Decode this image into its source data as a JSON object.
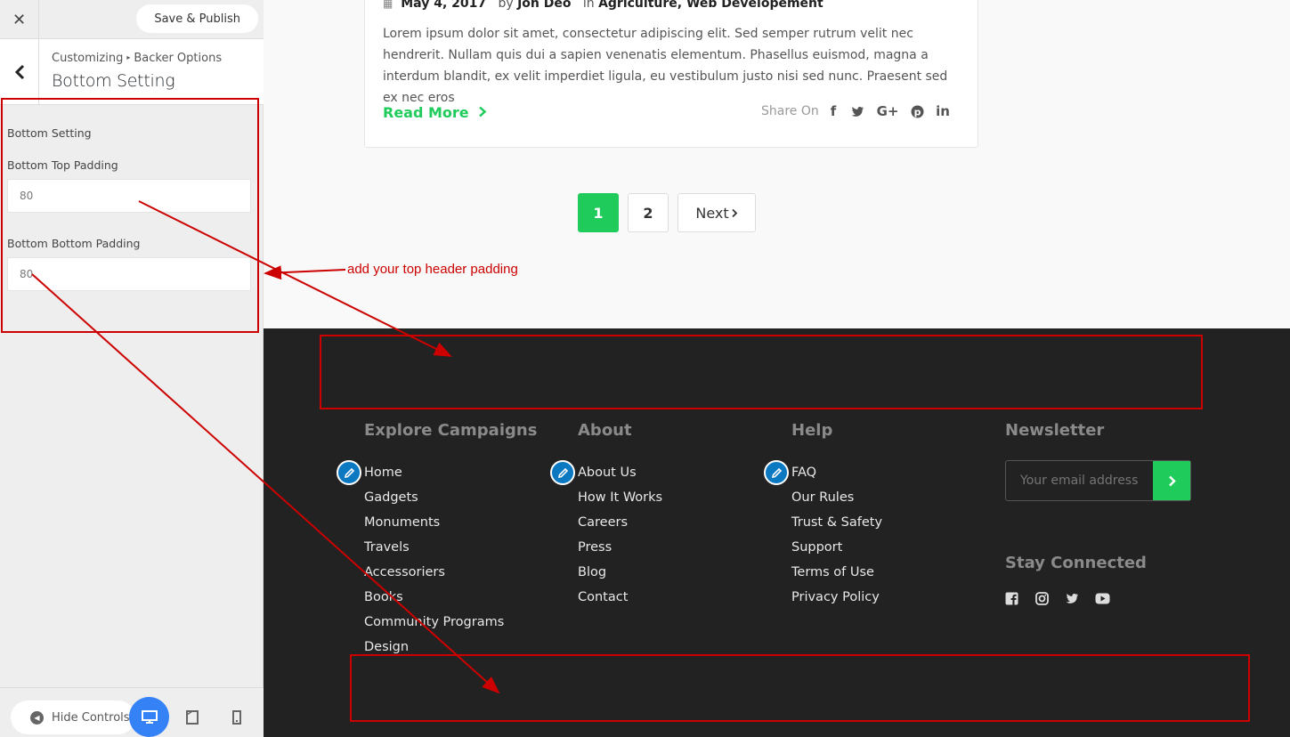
{
  "customizer": {
    "save_publish_label": "Save & Publish",
    "breadcrumb_root": "Customizing",
    "breadcrumb_section": "Backer Options",
    "section_title": "Bottom Setting",
    "group_label": "Bottom Setting",
    "top_padding_label": "Bottom Top Padding",
    "top_padding_value": "80",
    "bottom_padding_label": "Bottom Bottom Padding",
    "bottom_padding_value": "80",
    "hide_controls_label": "Hide Controls"
  },
  "post": {
    "date": "May 4, 2017",
    "by_label": "by",
    "author": "Jon Deo",
    "in_label": "in",
    "categories": "Agriculture, Web Developement",
    "excerpt": "Lorem ipsum dolor sit amet, consectetur adipiscing elit. Sed semper rutrum velit nec hendrerit. Nullam quis dui a sapien venenatis elementum. Phasellus euismod, magna a interdum blandit, ex velit imperdiet ligula, eu vestibulum justo nisi sed nunc. Praesent sed ex nec eros",
    "read_more": "Read More",
    "share_label": "Share On",
    "share_icons": [
      "facebook-icon",
      "twitter-icon",
      "google-plus-icon",
      "pinterest-icon",
      "linkedin-icon"
    ]
  },
  "pagination": {
    "page1": "1",
    "page2": "2",
    "next": "Next"
  },
  "annotation_text": "add your top header padding",
  "footer": {
    "explore": {
      "title": "Explore Campaigns",
      "items": [
        "Home",
        "Gadgets",
        "Monuments",
        "Travels",
        "Accessoriers",
        "Books",
        "Community Programs",
        "Design"
      ]
    },
    "about": {
      "title": "About",
      "items": [
        "About Us",
        "How It Works",
        "Careers",
        "Press",
        "Blog",
        "Contact"
      ]
    },
    "help": {
      "title": "Help",
      "items": [
        "FAQ",
        "Our Rules",
        "Trust & Safety",
        "Support",
        "Terms of Use",
        "Privacy Policy"
      ]
    },
    "newsletter": {
      "title": "Newsletter",
      "placeholder": "Your email address"
    },
    "stay_connected": "Stay Connected"
  },
  "colors": {
    "accent_green": "#1fcb5b",
    "footer_bg": "#222222",
    "annotation_red": "#cc0000",
    "device_active": "#3582f6",
    "edit_shortcut": "#0b78c2"
  }
}
